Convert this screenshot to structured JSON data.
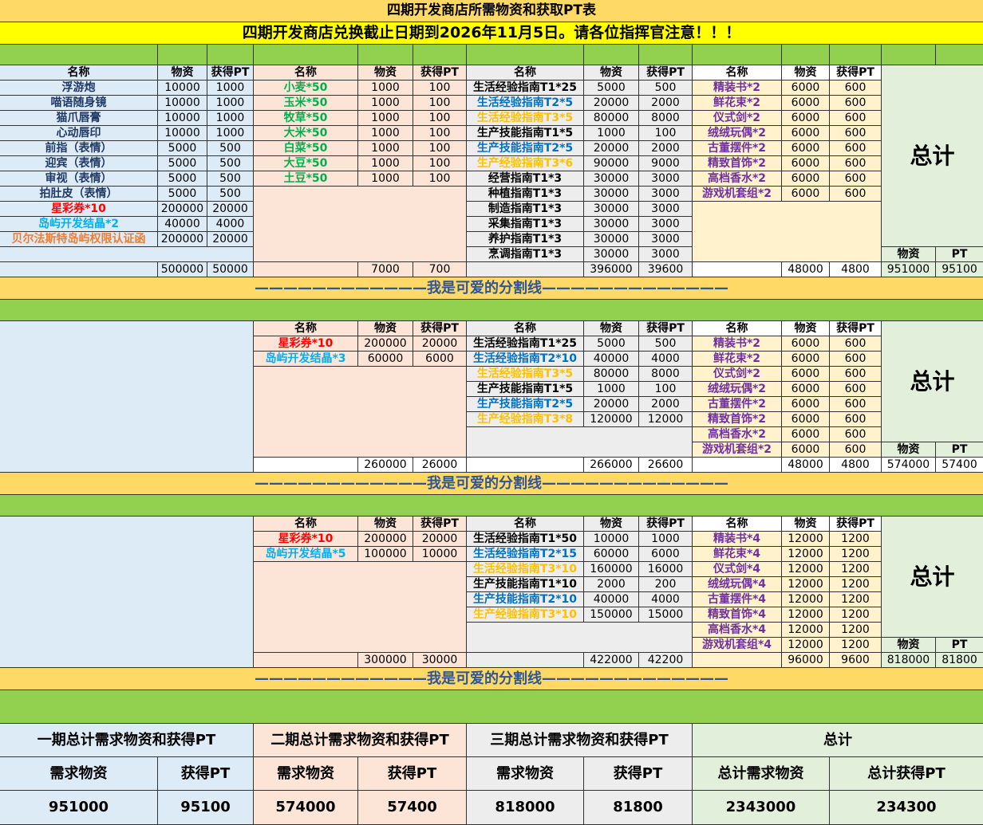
{
  "title": "四期开发商店所需物资和获取PT表",
  "notice": "四期开发商店兑换截止日期到2026年11月5日。请各位指挥官注意！！！",
  "divider": "————————————我是可爱的分割线—————————————",
  "headers": {
    "name": "名称",
    "material": "物资",
    "pt_gain": "获得PT",
    "total": "总计",
    "material_short": "物资",
    "pt": "PT"
  },
  "colors": {
    "title_bg": "#FFD966",
    "notice_bg": "#FFFF00",
    "green_band": "#92D050",
    "blue_bg": "#DDEBF7",
    "peach_bg": "#FCE4D6",
    "gray_bg": "#EDEDED",
    "cream_bg": "#FFF2CC",
    "total_bg": "#E2EFDA",
    "dark_blue": "#1F3864",
    "green_text": "#00B050",
    "gold_text": "#FFC000",
    "blue_text": "#0070C0",
    "purple_text": "#7030A0",
    "red_text": "#FF0000",
    "cyan_text": "#00B0F0",
    "orange_text": "#ED7D31",
    "divider_text": "#2F5597"
  },
  "section1": {
    "group_a": {
      "rows": [
        {
          "name": "浮游炮",
          "material": "10000",
          "pt": "1000",
          "color": "#1F3864"
        },
        {
          "name": "喵语随身镜",
          "material": "10000",
          "pt": "1000",
          "color": "#1F3864"
        },
        {
          "name": "猫爪唇膏",
          "material": "10000",
          "pt": "1000",
          "color": "#1F3864"
        },
        {
          "name": "心动唇印",
          "material": "10000",
          "pt": "1000",
          "color": "#1F3864"
        },
        {
          "name": "前指（表情）",
          "material": "5000",
          "pt": "500",
          "color": "#1F3864"
        },
        {
          "name": "迎宾（表情）",
          "material": "5000",
          "pt": "500",
          "color": "#1F3864"
        },
        {
          "name": "审视（表情）",
          "material": "5000",
          "pt": "500",
          "color": "#1F3864"
        },
        {
          "name": "拍肚皮（表情）",
          "material": "5000",
          "pt": "500",
          "color": "#1F3864"
        },
        {
          "name": "星彩券*10",
          "material": "200000",
          "pt": "20000",
          "color": "#FF0000"
        },
        {
          "name": "岛屿开发结晶*2",
          "material": "40000",
          "pt": "4000",
          "color": "#00B0F0"
        },
        {
          "name": "贝尔法斯特岛屿权限认证函",
          "material": "200000",
          "pt": "20000",
          "color": "#ED7D31"
        }
      ],
      "total_material": "500000",
      "total_pt": "50000"
    },
    "group_b": {
      "rows": [
        {
          "name": "小麦*50",
          "material": "1000",
          "pt": "100",
          "color": "#00B050"
        },
        {
          "name": "玉米*50",
          "material": "1000",
          "pt": "100",
          "color": "#00B050"
        },
        {
          "name": "牧草*50",
          "material": "1000",
          "pt": "100",
          "color": "#00B050"
        },
        {
          "name": "大米*50",
          "material": "1000",
          "pt": "100",
          "color": "#00B050"
        },
        {
          "name": "白菜*50",
          "material": "1000",
          "pt": "100",
          "color": "#00B050"
        },
        {
          "name": "大豆*50",
          "material": "1000",
          "pt": "100",
          "color": "#00B050"
        },
        {
          "name": "土豆*50",
          "material": "1000",
          "pt": "100",
          "color": "#00B050"
        }
      ],
      "total_material": "7000",
      "total_pt": "700"
    },
    "group_c": {
      "rows": [
        {
          "name": "生活经验指南T1*25",
          "material": "5000",
          "pt": "500",
          "color": "#000000"
        },
        {
          "name": "生活经验指南T2*5",
          "material": "20000",
          "pt": "2000",
          "color": "#0070C0"
        },
        {
          "name": "生活经验指南T3*5",
          "material": "80000",
          "pt": "8000",
          "color": "#FFC000"
        },
        {
          "name": "生产技能指南T1*5",
          "material": "1000",
          "pt": "100",
          "color": "#000000"
        },
        {
          "name": "生产技能指南T2*5",
          "material": "20000",
          "pt": "2000",
          "color": "#0070C0"
        },
        {
          "name": "生产经验指南T3*6",
          "material": "90000",
          "pt": "9000",
          "color": "#FFC000"
        },
        {
          "name": "经营指南T1*3",
          "material": "30000",
          "pt": "3000",
          "color": "#000000"
        },
        {
          "name": "种植指南T1*3",
          "material": "30000",
          "pt": "3000",
          "color": "#000000"
        },
        {
          "name": "制造指南T1*3",
          "material": "30000",
          "pt": "3000",
          "color": "#000000"
        },
        {
          "name": "采集指南T1*3",
          "material": "30000",
          "pt": "3000",
          "color": "#000000"
        },
        {
          "name": "养护指南T1*3",
          "material": "30000",
          "pt": "3000",
          "color": "#000000"
        },
        {
          "name": "烹调指南T1*3",
          "material": "30000",
          "pt": "3000",
          "color": "#000000"
        }
      ],
      "total_material": "396000",
      "total_pt": "39600"
    },
    "group_d": {
      "rows": [
        {
          "name": "精装书*2",
          "material": "6000",
          "pt": "600",
          "color": "#7030A0"
        },
        {
          "name": "鲜花束*2",
          "material": "6000",
          "pt": "600",
          "color": "#7030A0"
        },
        {
          "name": "仪式剑*2",
          "material": "6000",
          "pt": "600",
          "color": "#7030A0"
        },
        {
          "name": "绒绒玩偶*2",
          "material": "6000",
          "pt": "600",
          "color": "#7030A0"
        },
        {
          "name": "古董摆件*2",
          "material": "6000",
          "pt": "600",
          "color": "#7030A0"
        },
        {
          "name": "精致首饰*2",
          "material": "6000",
          "pt": "600",
          "color": "#7030A0"
        },
        {
          "name": "高档香水*2",
          "material": "6000",
          "pt": "600",
          "color": "#7030A0"
        },
        {
          "name": "游戏机套组*2",
          "material": "6000",
          "pt": "600",
          "color": "#7030A0"
        }
      ],
      "total_material": "48000",
      "total_pt": "4800"
    },
    "grand_material": "951000",
    "grand_pt": "95100"
  },
  "section2": {
    "group_b": {
      "rows": [
        {
          "name": "星彩券*10",
          "material": "200000",
          "pt": "20000",
          "color": "#FF0000"
        },
        {
          "name": "岛屿开发结晶*3",
          "material": "60000",
          "pt": "6000",
          "color": "#00B0F0"
        }
      ],
      "total_material": "260000",
      "total_pt": "26000"
    },
    "group_c": {
      "rows": [
        {
          "name": "生活经验指南T1*25",
          "material": "5000",
          "pt": "500",
          "color": "#000000"
        },
        {
          "name": "生活经验指南T2*10",
          "material": "40000",
          "pt": "4000",
          "color": "#0070C0"
        },
        {
          "name": "生活经验指南T3*5",
          "material": "80000",
          "pt": "8000",
          "color": "#FFC000"
        },
        {
          "name": "生产技能指南T1*5",
          "material": "1000",
          "pt": "100",
          "color": "#000000"
        },
        {
          "name": "生产技能指南T2*5",
          "material": "20000",
          "pt": "2000",
          "color": "#0070C0"
        },
        {
          "name": "生产经验指南T3*8",
          "material": "120000",
          "pt": "12000",
          "color": "#FFC000"
        }
      ],
      "total_material": "266000",
      "total_pt": "26600"
    },
    "group_d": {
      "rows": [
        {
          "name": "精装书*2",
          "material": "6000",
          "pt": "600",
          "color": "#7030A0"
        },
        {
          "name": "鲜花束*2",
          "material": "6000",
          "pt": "600",
          "color": "#7030A0"
        },
        {
          "name": "仪式剑*2",
          "material": "6000",
          "pt": "600",
          "color": "#7030A0"
        },
        {
          "name": "绒绒玩偶*2",
          "material": "6000",
          "pt": "600",
          "color": "#7030A0"
        },
        {
          "name": "古董摆件*2",
          "material": "6000",
          "pt": "600",
          "color": "#7030A0"
        },
        {
          "name": "精致首饰*2",
          "material": "6000",
          "pt": "600",
          "color": "#7030A0"
        },
        {
          "name": "高档香水*2",
          "material": "6000",
          "pt": "600",
          "color": "#7030A0"
        },
        {
          "name": "游戏机套组*2",
          "material": "6000",
          "pt": "600",
          "color": "#7030A0"
        }
      ],
      "total_material": "48000",
      "total_pt": "4800"
    },
    "grand_material": "574000",
    "grand_pt": "57400"
  },
  "section3": {
    "group_b": {
      "rows": [
        {
          "name": "星彩券*10",
          "material": "200000",
          "pt": "20000",
          "color": "#FF0000"
        },
        {
          "name": "岛屿开发结晶*5",
          "material": "100000",
          "pt": "10000",
          "color": "#00B0F0"
        }
      ],
      "total_material": "300000",
      "total_pt": "30000"
    },
    "group_c": {
      "rows": [
        {
          "name": "生活经验指南T1*50",
          "material": "10000",
          "pt": "1000",
          "color": "#000000"
        },
        {
          "name": "生活经验指南T2*15",
          "material": "60000",
          "pt": "6000",
          "color": "#0070C0"
        },
        {
          "name": "生活经验指南T3*10",
          "material": "160000",
          "pt": "16000",
          "color": "#FFC000"
        },
        {
          "name": "生产技能指南T1*10",
          "material": "2000",
          "pt": "200",
          "color": "#000000"
        },
        {
          "name": "生产技能指南T2*10",
          "material": "40000",
          "pt": "4000",
          "color": "#0070C0"
        },
        {
          "name": "生产经验指南T3*10",
          "material": "150000",
          "pt": "15000",
          "color": "#FFC000"
        }
      ],
      "total_material": "422000",
      "total_pt": "42200"
    },
    "group_d": {
      "rows": [
        {
          "name": "精装书*4",
          "material": "12000",
          "pt": "1200",
          "color": "#7030A0"
        },
        {
          "name": "鲜花束*4",
          "material": "12000",
          "pt": "1200",
          "color": "#7030A0"
        },
        {
          "name": "仪式剑*4",
          "material": "12000",
          "pt": "1200",
          "color": "#7030A0"
        },
        {
          "name": "绒绒玩偶*4",
          "material": "12000",
          "pt": "1200",
          "color": "#7030A0"
        },
        {
          "name": "古董摆件*4",
          "material": "12000",
          "pt": "1200",
          "color": "#7030A0"
        },
        {
          "name": "精致首饰*4",
          "material": "12000",
          "pt": "1200",
          "color": "#7030A0"
        },
        {
          "name": "高档香水*4",
          "material": "12000",
          "pt": "1200",
          "color": "#7030A0"
        },
        {
          "name": "游戏机套组*4",
          "material": "12000",
          "pt": "1200",
          "color": "#7030A0"
        }
      ],
      "total_material": "96000",
      "total_pt": "9600"
    },
    "grand_material": "818000",
    "grand_pt": "81800"
  },
  "summary": {
    "phase1_title": "一期总计需求物资和获得PT",
    "phase2_title": "二期总计需求物资和获得PT",
    "phase3_title": "三期总计需求物资和获得PT",
    "total_title": "总计",
    "need_label": "需求物资",
    "gain_label": "获得PT",
    "total_need_label": "总计需求物资",
    "total_gain_label": "总计获得PT",
    "phase1_material": "951000",
    "phase1_pt": "95100",
    "phase2_material": "574000",
    "phase2_pt": "57400",
    "phase3_material": "818000",
    "phase3_pt": "81800",
    "total_material": "2343000",
    "total_pt": "234300"
  }
}
